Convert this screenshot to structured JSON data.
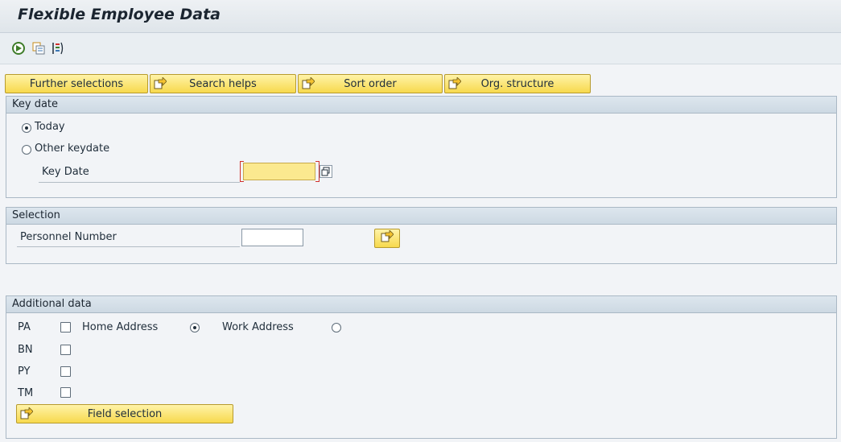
{
  "title": "Flexible Employee Data",
  "toolbar": {
    "icons": [
      "execute-icon",
      "copy-variant-icon",
      "selection-options-icon"
    ]
  },
  "buttons": {
    "further_selections": "Further selections",
    "search_helps": "Search helps",
    "sort_order": "Sort order",
    "org_structure": "Org. structure",
    "field_selection": "Field selection"
  },
  "key_date_group": {
    "header": "Key date",
    "today_label": "Today",
    "today_selected": true,
    "other_keydate_label": "Other keydate",
    "key_date_label": "Key Date",
    "key_date_value": ""
  },
  "selection_group": {
    "header": "Selection",
    "personnel_number_label": "Personnel Number",
    "personnel_number_value": ""
  },
  "additional_group": {
    "header": "Additional data",
    "rows": [
      {
        "code": "PA",
        "checked": false
      },
      {
        "code": "BN",
        "checked": false
      },
      {
        "code": "PY",
        "checked": false
      },
      {
        "code": "TM",
        "checked": false
      }
    ],
    "home_address_label": "Home Address",
    "work_address_label": "Work Address",
    "home_address_selected": true
  },
  "colors": {
    "button_yellow": "#f7d94d",
    "required_field": "#fbe98f",
    "group_header": "#cdd9e3"
  }
}
